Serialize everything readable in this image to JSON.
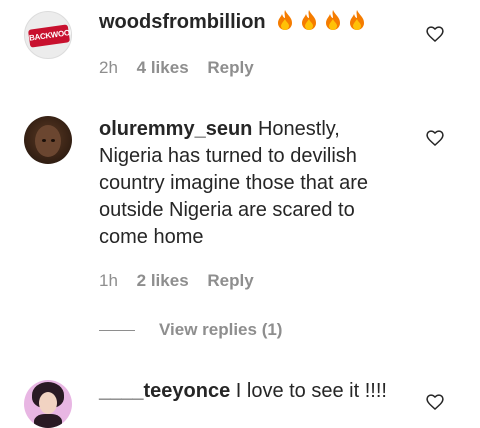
{
  "comments": [
    {
      "username": "woodsfrombillion",
      "text": "🔥🔥🔥🔥",
      "time": "2h",
      "likes": "4 likes",
      "reply_label": "Reply",
      "avatar_logo_text": "BACKWOODS",
      "avatar_icon": "backwoods-logo-avatar"
    },
    {
      "username": "oluremmy_seun",
      "text": "Honestly, Nigeria has turned to devilish country imagine those that are outside Nigeria are scared to come home",
      "time": "1h",
      "likes": "2 likes",
      "reply_label": "Reply",
      "view_replies": "View replies (1)",
      "avatar_icon": "user-photo-avatar"
    },
    {
      "username": "____teeyonce",
      "text": "I love to see it !!!!",
      "avatar_icon": "user-photo-avatar"
    }
  ],
  "icons": {
    "like": "heart-outline-icon",
    "emoji": "fire-emoji"
  },
  "colors": {
    "text": "#262626",
    "muted": "#8e8e8e",
    "background": "#ffffff"
  }
}
